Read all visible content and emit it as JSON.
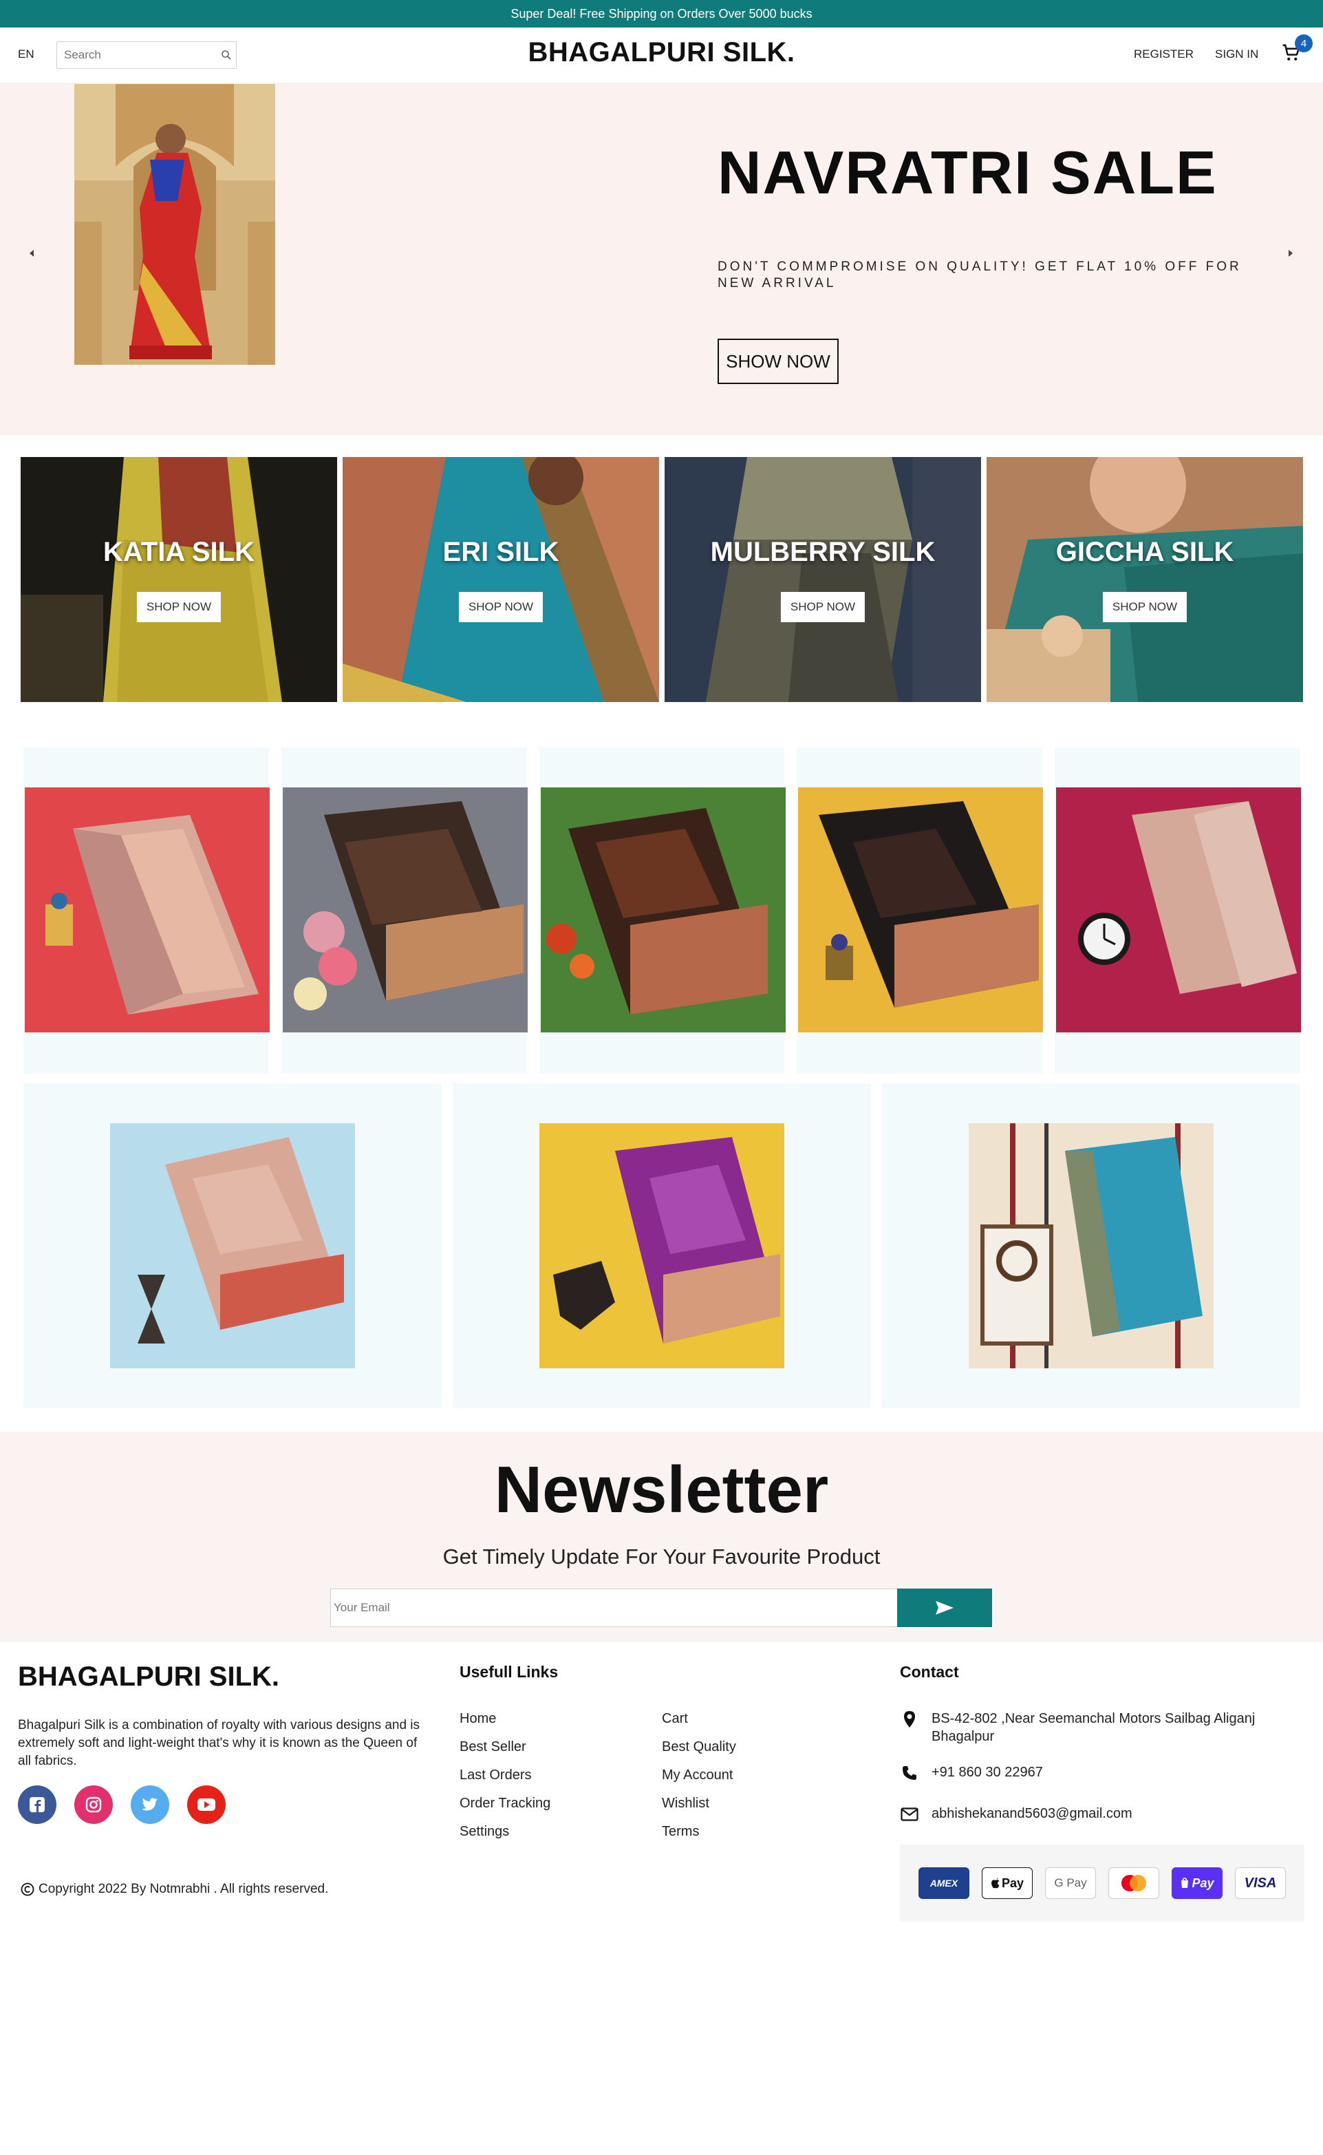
{
  "promo": {
    "text": "Super Deal! Free Shipping on Orders Over 5000 bucks"
  },
  "header": {
    "lang": "EN",
    "search_placeholder": "Search",
    "brand": "BHAGALPURI SILK.",
    "register": "REGISTER",
    "signin": "SIGN IN",
    "cart_count": "4"
  },
  "hero": {
    "title": "NAVRATRI SALE",
    "subtitle": "DON'T COMMPROMISE ON QUALITY! GET FLAT 10% OFF FOR NEW ARRIVAL",
    "button": "SHOW NOW"
  },
  "categories": [
    {
      "name": "KATIA SILK",
      "button": "SHOP NOW"
    },
    {
      "name": "ERI SILK",
      "button": "SHOP NOW"
    },
    {
      "name": "MULBERRY SILK",
      "button": "SHOP NOW"
    },
    {
      "name": "GICCHA SILK",
      "button": "SHOP NOW"
    }
  ],
  "newsletter": {
    "title": "Newsletter",
    "subtitle": "Get Timely Update For Your Favourite Product",
    "placeholder": "Your Email"
  },
  "footer": {
    "brand": "BHAGALPURI SILK.",
    "description": "Bhagalpuri Silk is a combination of royalty with various designs and is extremely soft and light-weight that's why it is known as the Queen of all fabrics.",
    "links_heading": "Usefull Links",
    "links_col1": [
      "Home",
      "Best Seller",
      "Last Orders",
      "Order Tracking",
      "Settings"
    ],
    "links_col2": [
      "Cart",
      "Best Quality",
      "My Account",
      "Wishlist",
      "Terms"
    ],
    "contact_heading": "Contact",
    "address": "BS-42-802 ,Near Seemanchal Motors Sailbag Aliganj Bhagalpur",
    "phone": "+91 860 30 22967",
    "email": "abhishekanand5603@gmail.com",
    "copyright": "Copyright 2022 By Notmrabhi . All rights reserved.",
    "payments": [
      "AMEX",
      "Pay",
      "G Pay",
      "",
      "Pay",
      "VISA"
    ]
  },
  "colors": {
    "accent": "#0f7b7b",
    "hero_bg": "#fbf1ee",
    "card_bg": "#f3fafc"
  }
}
